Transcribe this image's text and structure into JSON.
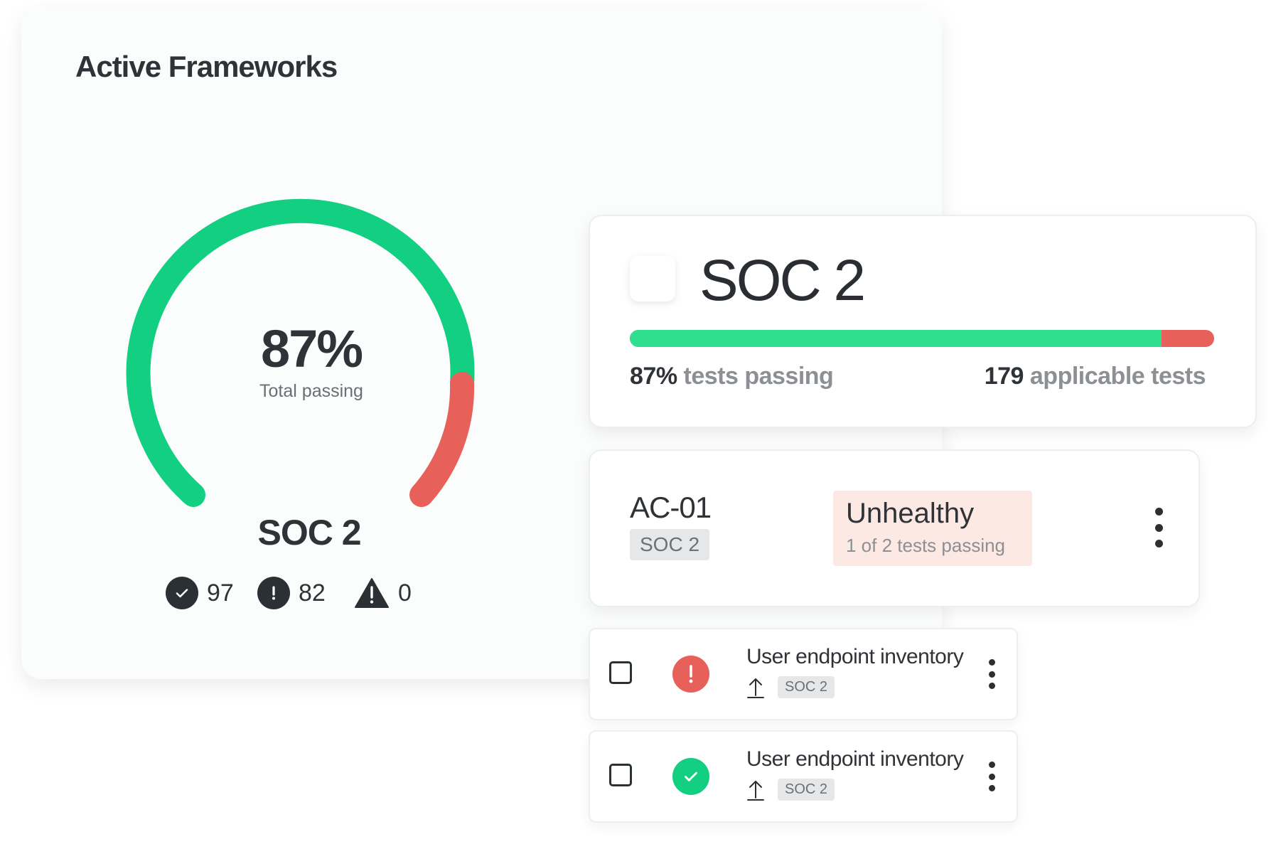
{
  "main": {
    "title": "Active Frameworks",
    "gauge": {
      "percent_label": "87%",
      "percent_value": 0.87,
      "sub_label": "Total passing",
      "framework": "SOC 2"
    },
    "stats": [
      {
        "icon": "check-circle-icon",
        "value": "97"
      },
      {
        "icon": "exclamation-circle-icon",
        "value": "82"
      },
      {
        "icon": "warning-triangle-icon",
        "value": "0"
      }
    ]
  },
  "soc_card": {
    "title": "SOC 2",
    "progress_value": 0.91,
    "passing_value": "87%",
    "passing_text": "tests passing",
    "applicable_value": "179",
    "applicable_text": "applicable tests"
  },
  "control": {
    "id": "AC-01",
    "tag": "SOC 2",
    "status_title": "Unhealthy",
    "status_sub": "1 of 2 tests passing"
  },
  "tests": [
    {
      "name": "User endpoint inventory",
      "tag": "SOC 2",
      "status": "failing",
      "icon": "exclamation-icon"
    },
    {
      "name": "User endpoint inventory",
      "tag": "SOC 2",
      "status": "passing",
      "icon": "check-icon"
    }
  ],
  "colors": {
    "green": "#13cf81",
    "red": "#e8605a",
    "dark": "#2b3034",
    "unhealthy_bg": "#fde9e3"
  }
}
